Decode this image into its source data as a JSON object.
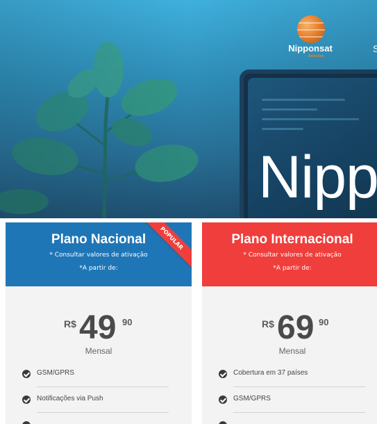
{
  "hero": {
    "title": "Nipp",
    "logo": {
      "name": "Nipponsat",
      "subtitle": "Soluções",
      "icon": "globe-icon",
      "color": "#e8812e"
    },
    "nav_fragment": "S"
  },
  "plans": [
    {
      "name": "Plano Nacional",
      "note": "* Consultar valores de ativação",
      "from_label": "*A partir de:",
      "badge": "POPULAR",
      "currency": "R$",
      "amount": "49",
      "cents": "90",
      "period": "Mensal",
      "header_color": "#1f76b7",
      "features": [
        "GSM/GPRS",
        "Notificações via Push",
        ""
      ]
    },
    {
      "name": "Plano Internacional",
      "note": "* Consultar valores de ativação",
      "from_label": "*A partir de:",
      "currency": "R$",
      "amount": "69",
      "cents": "90",
      "period": "Mensal",
      "header_color": "#ef3e3b",
      "features": [
        "Cobertura em 37 países",
        "GSM/GPRS",
        ""
      ]
    }
  ],
  "colors": {
    "hero_top": "#3fb0dd",
    "hero_bottom": "#1f4f70",
    "badge": "#ef3e3b",
    "card_bg": "#f3f3f3"
  }
}
